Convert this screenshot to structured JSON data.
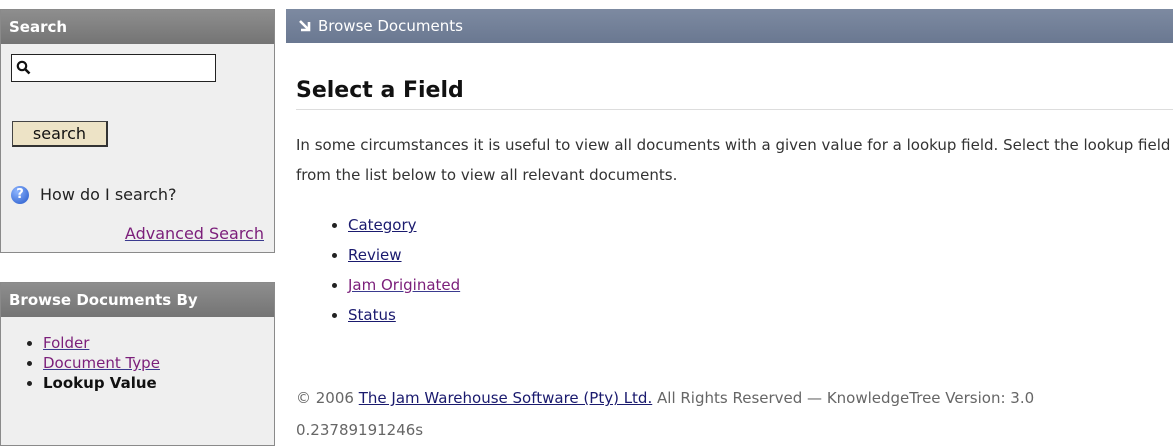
{
  "sidebar": {
    "search": {
      "header": "Search",
      "input_value": "",
      "button_label": "search",
      "help_text": "How do I search?",
      "advanced_link": "Advanced Search"
    },
    "browse": {
      "header": "Browse Documents By",
      "items": [
        {
          "label": "Folder"
        },
        {
          "label": "Document Type"
        },
        {
          "label": "Lookup Value"
        }
      ]
    }
  },
  "main": {
    "breadcrumb": "Browse Documents",
    "title": "Select a Field",
    "intro": "In some circumstances it is useful to view all documents with a given value for a lookup field. Select the lookup field from the list below to view all relevant documents.",
    "fields": [
      "Category",
      "Review",
      "Jam Originated",
      "Status"
    ]
  },
  "footer": {
    "copyright": "© 2006",
    "company_link": "The Jam Warehouse Software (Pty) Ltd.",
    "rights": "All Rights Reserved — KnowledgeTree Version: 3.0",
    "timing": "0.23789191246s"
  },
  "colors": {
    "breadcrumb_bar": "#6f7d95",
    "portlet_header": "#808080",
    "visited_link": "#7b1e7a",
    "link": "#1a1a6e"
  }
}
